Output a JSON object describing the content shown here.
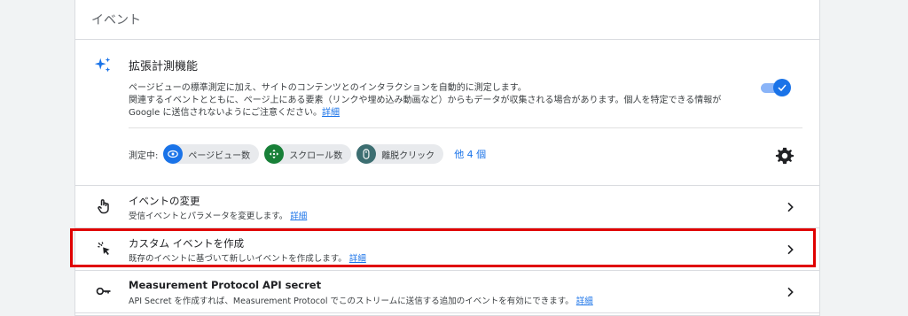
{
  "section": {
    "title": "イベント"
  },
  "enhanced_measurement": {
    "title": "拡張計測機能",
    "desc_line1": "ページビューの標準測定に加え、サイトのコンテンツとのインタラクションを自動的に測定します。",
    "desc_line2": "関連するイベントとともに、ページ上にある要素（リンクや埋め込み動画など）からもデータが収集される場合があります。個人を特定できる情報が",
    "desc_line3": "Google に送信されないようにご注意ください。",
    "details_link": "詳細",
    "toggle_on": true,
    "measuring_label": "測定中:",
    "chips": [
      {
        "label": "ページビュー数",
        "icon": "eye-icon",
        "color": "#1a73e8"
      },
      {
        "label": "スクロール数",
        "icon": "scroll-arrows-icon",
        "color": "#188038"
      },
      {
        "label": "離脱クリック",
        "icon": "mouse-icon",
        "color": "#3c6e71"
      }
    ],
    "more_label": "他 4 個"
  },
  "rows": [
    {
      "title": "イベントの変更",
      "desc": "受信イベントとパラメータを変更します。",
      "link": "詳細",
      "icon": "touch-hand-icon"
    },
    {
      "title": "カスタム イベントを作成",
      "desc": "既存のイベントに基づいて新しいイベントを作成します。",
      "link": "詳細",
      "icon": "cursor-click-icon"
    },
    {
      "title": "Measurement Protocol API secret",
      "desc": "API Secret を作成すれば、Measurement Protocol でこのストリームに送信する追加のイベントを有効にできます。",
      "link": "詳細",
      "icon": "key-icon"
    }
  ],
  "colors": {
    "accent": "#1a73e8",
    "highlight": "#e00000"
  }
}
